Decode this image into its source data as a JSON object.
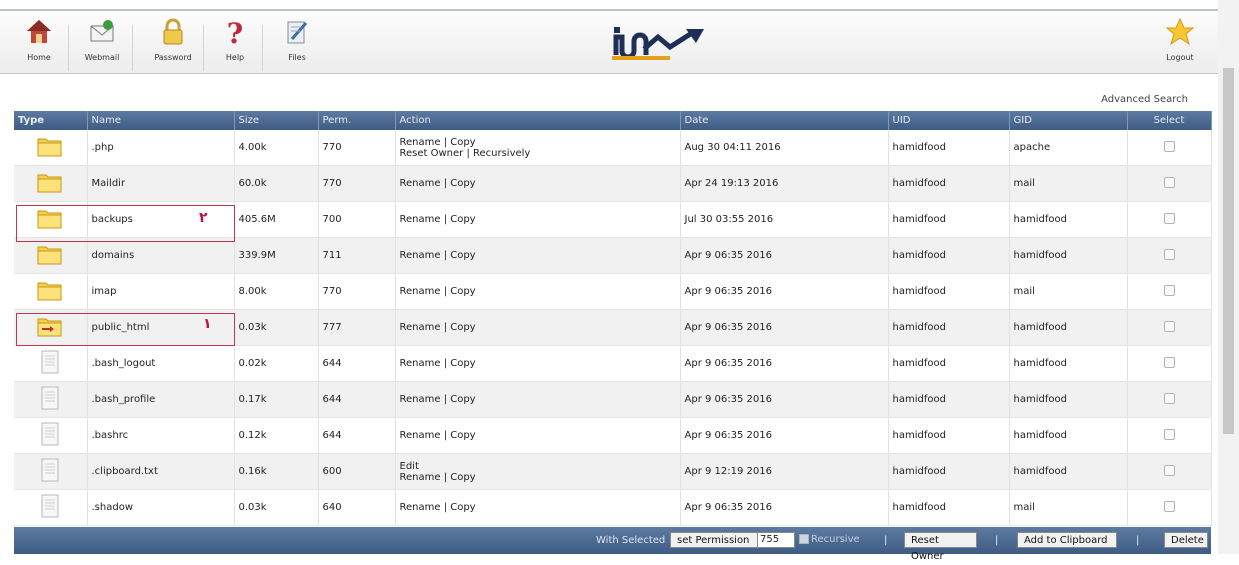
{
  "toolbar": {
    "home": "Home",
    "webmail": "Webmail",
    "password": "Password",
    "help": "Help",
    "files": "Files",
    "logout": "Logout"
  },
  "advanced_search": "Advanced Search",
  "columns": {
    "type": "Type",
    "name": "Name",
    "size": "Size",
    "perm": "Perm.",
    "action": "Action",
    "date": "Date",
    "uid": "UID",
    "gid": "GID",
    "select": "Select"
  },
  "rows": [
    {
      "kind": "folder",
      "name": ".php",
      "size": "4.00k",
      "perm": "770",
      "action1": "Rename | Copy",
      "action2": "Reset Owner | Recursively",
      "date": "Aug 30 04:11 2016",
      "uid": "hamidfood",
      "gid": "apache"
    },
    {
      "kind": "folder",
      "name": "Maildir",
      "size": "60.0k",
      "perm": "770",
      "action1": "Rename | Copy",
      "action2": "",
      "date": "Apr 24 19:13 2016",
      "uid": "hamidfood",
      "gid": "mail"
    },
    {
      "kind": "folder",
      "name": "backups",
      "size": "405.6M",
      "perm": "700",
      "action1": "Rename | Copy",
      "action2": "",
      "date": "Jul 30 03:55 2016",
      "uid": "hamidfood",
      "gid": "hamidfood"
    },
    {
      "kind": "folder",
      "name": "domains",
      "size": "339.9M",
      "perm": "711",
      "action1": "Rename | Copy",
      "action2": "",
      "date": "Apr 9 06:35 2016",
      "uid": "hamidfood",
      "gid": "hamidfood"
    },
    {
      "kind": "folder",
      "name": "imap",
      "size": "8.00k",
      "perm": "770",
      "action1": "Rename | Copy",
      "action2": "",
      "date": "Apr 9 06:35 2016",
      "uid": "hamidfood",
      "gid": "mail"
    },
    {
      "kind": "link-folder",
      "name": "public_html",
      "size": "0.03k",
      "perm": "777",
      "action1": "Rename | Copy",
      "action2": "",
      "date": "Apr 9 06:35 2016",
      "uid": "hamidfood",
      "gid": "hamidfood"
    },
    {
      "kind": "file",
      "name": ".bash_logout",
      "size": "0.02k",
      "perm": "644",
      "action1": "Rename | Copy",
      "action2": "",
      "date": "Apr 9 06:35 2016",
      "uid": "hamidfood",
      "gid": "hamidfood"
    },
    {
      "kind": "file",
      "name": ".bash_profile",
      "size": "0.17k",
      "perm": "644",
      "action1": "Rename | Copy",
      "action2": "",
      "date": "Apr 9 06:35 2016",
      "uid": "hamidfood",
      "gid": "hamidfood"
    },
    {
      "kind": "file",
      "name": ".bashrc",
      "size": "0.12k",
      "perm": "644",
      "action1": "Rename | Copy",
      "action2": "",
      "date": "Apr 9 06:35 2016",
      "uid": "hamidfood",
      "gid": "hamidfood"
    },
    {
      "kind": "file",
      "name": ".clipboard.txt",
      "size": "0.16k",
      "perm": "600",
      "action1": "Edit",
      "action2": "Rename | Copy",
      "date": "Apr 9 12:19 2016",
      "uid": "hamidfood",
      "gid": "hamidfood"
    },
    {
      "kind": "file",
      "name": ".shadow",
      "size": "0.03k",
      "perm": "640",
      "action1": "Rename | Copy",
      "action2": "",
      "date": "Apr 9 06:35 2016",
      "uid": "hamidfood",
      "gid": "mail"
    }
  ],
  "annotations": {
    "one": "١",
    "two": "٢"
  },
  "bottom": {
    "with_selected": "With Selected",
    "set_permission": "set Permission",
    "perm_value": "755",
    "recursive": "Recursive",
    "pipe": "|",
    "reset_owner": "Reset Owner",
    "add_clipboard": "Add to Clipboard",
    "delete": "Delete"
  },
  "colors": {
    "header": "#4a6890",
    "highlight": "#c0374b"
  }
}
